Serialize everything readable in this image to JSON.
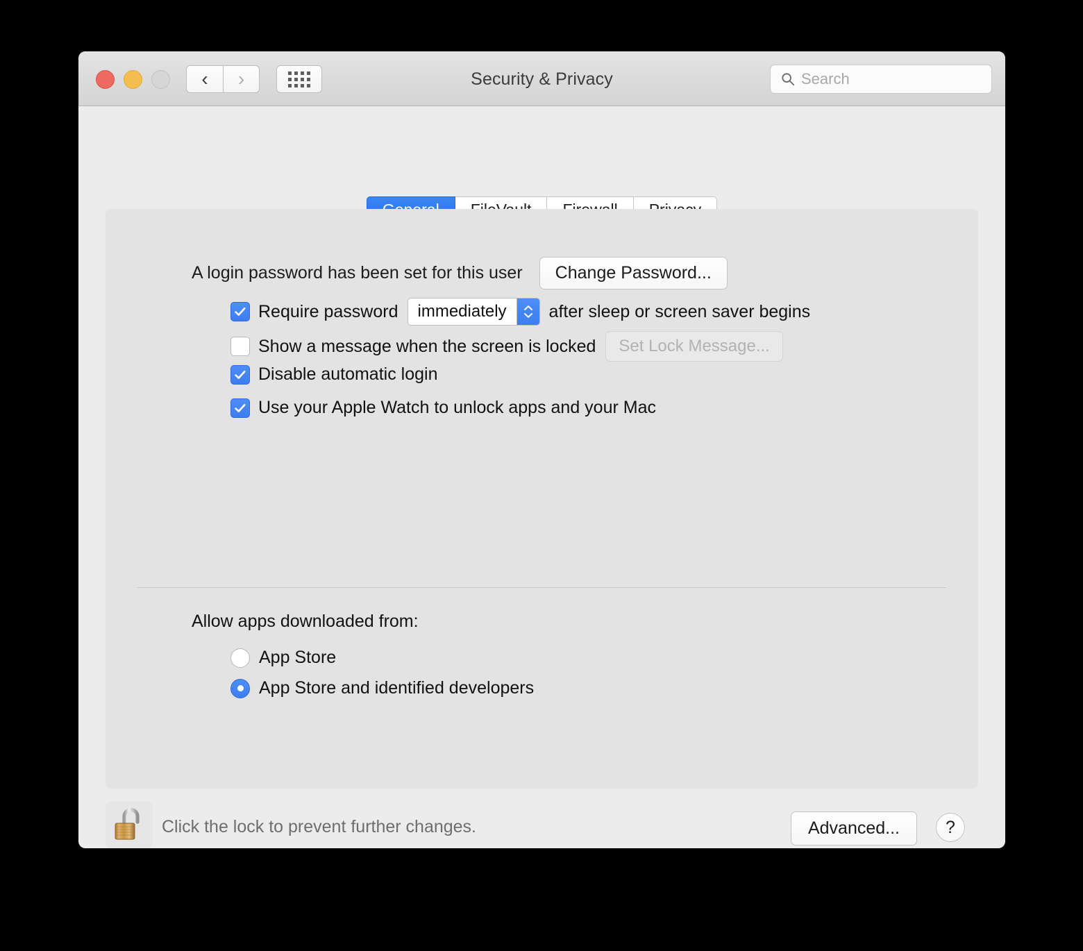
{
  "window": {
    "title": "Security & Privacy",
    "traffic_lights": {
      "close": "close-button",
      "minimize": "minimize-button",
      "zoom": "zoom-button"
    },
    "nav": {
      "back": "‹",
      "forward": "›",
      "grid": "show-all-icon"
    },
    "search": {
      "placeholder": "Search",
      "value": ""
    }
  },
  "tabs": [
    {
      "label": "General",
      "selected": true
    },
    {
      "label": "FileVault",
      "selected": false
    },
    {
      "label": "Firewall",
      "selected": false
    },
    {
      "label": "Privacy",
      "selected": false
    }
  ],
  "general": {
    "password_status": "A login password has been set for this user",
    "change_password_label": "Change Password...",
    "require_password": {
      "checked": true,
      "label_before": "Require password",
      "interval_value": "immediately",
      "label_after": "after sleep or screen saver begins"
    },
    "show_lock_message": {
      "checked": false,
      "label": "Show a message when the screen is locked",
      "button_label": "Set Lock Message...",
      "button_disabled": true
    },
    "disable_automatic_login": {
      "checked": true,
      "label": "Disable automatic login"
    },
    "apple_watch_unlock": {
      "checked": true,
      "label": "Use your Apple Watch to unlock apps and your Mac"
    },
    "allow_apps_heading": "Allow apps downloaded from:",
    "allow_apps_options": [
      {
        "label": "App Store",
        "selected": false
      },
      {
        "label": "App Store and identified developers",
        "selected": true
      }
    ]
  },
  "footer": {
    "lock_icon": "unlocked-padlock-icon",
    "lock_text": "Click the lock to prevent further changes.",
    "advanced_label": "Advanced...",
    "help_label": "?"
  },
  "colors": {
    "accent_blue": "#3d7def",
    "tab_selected": "#3a86f5",
    "window_bg": "#ececec",
    "panel_bg": "#e3e3e3",
    "titlebar_top": "#e4e4e4",
    "titlebar_bottom": "#d4d4d4",
    "close_red": "#ec6a5f",
    "minimize_yellow": "#f4bd4f",
    "zoom_grey": "#d6d6d6",
    "lock_gold": "#c79a4e",
    "disabled_grey": "#b2b2b2"
  }
}
